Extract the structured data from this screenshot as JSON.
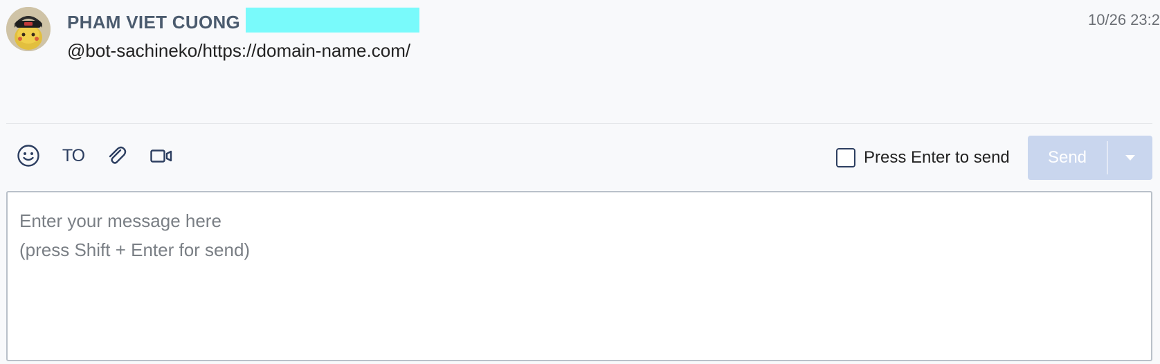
{
  "message": {
    "sender_name": "PHAM VIET CUONG",
    "timestamp": "10/26 23:2",
    "body": "@bot-sachineko/https://domain-name.com/",
    "highlight_color": "#79fafb"
  },
  "toolbar": {
    "to_label": "TO",
    "icons": [
      "smiley-icon",
      "to-icon",
      "paperclip-icon",
      "video-call-icon"
    ],
    "press_enter_label": "Press Enter to send",
    "press_enter_checked": false,
    "send_label": "Send",
    "send_button_color": "#c9d6ee"
  },
  "composer": {
    "placeholder": "Enter your message here\n(press Shift + Enter for send)",
    "value": ""
  },
  "colors": {
    "accent": "#2c3e60",
    "background": "#f8f9fb"
  }
}
